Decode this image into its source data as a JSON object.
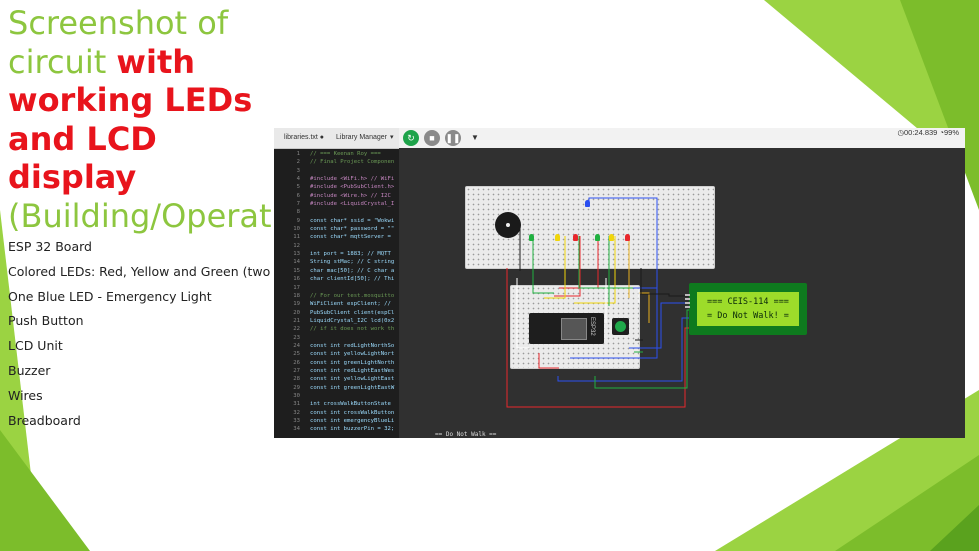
{
  "slide": {
    "title_plain_1": "Screenshot of circuit ",
    "title_emph": "with working LEDs and LCD display",
    "title_plain_2": " (Building/Operation)",
    "bullets": [
      "ESP 32 Board",
      "Colored LEDs: Red, Yellow and Green (two sets)",
      "One Blue LED - Emergency Light",
      "Push Button",
      "LCD Unit",
      "Buzzer",
      "Wires",
      "Breadboard"
    ]
  },
  "editor": {
    "tabs": [
      "libraries.txt ●",
      "Library Manager",
      "▾"
    ],
    "lines": [
      {
        "n": "1",
        "t": "// === Keenan Roy ==="
      },
      {
        "n": "2",
        "t": "// Final Project Componen"
      },
      {
        "n": "3",
        "t": ""
      },
      {
        "n": "4",
        "t": "#include <WiFi.h> // WiFi"
      },
      {
        "n": "5",
        "t": "#include <PubSubClient.h>"
      },
      {
        "n": "6",
        "t": "#include <Wire.h> // I2C"
      },
      {
        "n": "7",
        "t": "#include <LiquidCrystal_I"
      },
      {
        "n": "8",
        "t": ""
      },
      {
        "n": "9",
        "t": "const char* ssid = \"Wokwi"
      },
      {
        "n": "10",
        "t": "const char* password = \"\""
      },
      {
        "n": "11",
        "t": "const char* mqttServer ="
      },
      {
        "n": "12",
        "t": ""
      },
      {
        "n": "13",
        "t": "int port = 1883; // MQTT"
      },
      {
        "n": "14",
        "t": "String stMac; // C string"
      },
      {
        "n": "15",
        "t": "char mac[50]; // C char a"
      },
      {
        "n": "16",
        "t": "char clientId[50]; // Thi"
      },
      {
        "n": "17",
        "t": ""
      },
      {
        "n": "18",
        "t": "// For our test.mosquitto"
      },
      {
        "n": "19",
        "t": "WiFiClient espClient; //"
      },
      {
        "n": "20",
        "t": "PubSubClient client(espCl"
      },
      {
        "n": "21",
        "t": "LiquidCrystal_I2C lcd(0x2"
      },
      {
        "n": "22",
        "t": "// if it does not work th"
      },
      {
        "n": "23",
        "t": ""
      },
      {
        "n": "24",
        "t": "const int redLightNorthSo"
      },
      {
        "n": "25",
        "t": "const int yellowLightNort"
      },
      {
        "n": "26",
        "t": "const int greenLightNorth"
      },
      {
        "n": "27",
        "t": "const int redLightEastWes"
      },
      {
        "n": "28",
        "t": "const int yellowLightEast"
      },
      {
        "n": "29",
        "t": "const int greenLightEastW"
      },
      {
        "n": "30",
        "t": ""
      },
      {
        "n": "31",
        "t": "int crossWalkButtonState"
      },
      {
        "n": "32",
        "t": "const int crossWalkButton"
      },
      {
        "n": "33",
        "t": "const int emergencyBlueLi"
      },
      {
        "n": "34",
        "t": "const int buzzerPin = 32;"
      }
    ]
  },
  "sim": {
    "timer": "00:24.839",
    "cpu": "99%",
    "lcd_line1": "=== CEIS-114 ===",
    "lcd_line2": "= Do Not Walk! =",
    "esp_label": "ESP32",
    "serial_overflow": "== Do Not Walk =="
  },
  "colors": {
    "title_green": "#8dc63f",
    "title_red": "#e8141c",
    "sim_bg": "#303030",
    "lcd_board": "#0e7a1e",
    "lcd_screen": "#9ddc2a",
    "led_red": "#e8272c",
    "led_yellow": "#f0d50a",
    "led_green": "#20b040",
    "led_blue": "#2a4ef0"
  }
}
